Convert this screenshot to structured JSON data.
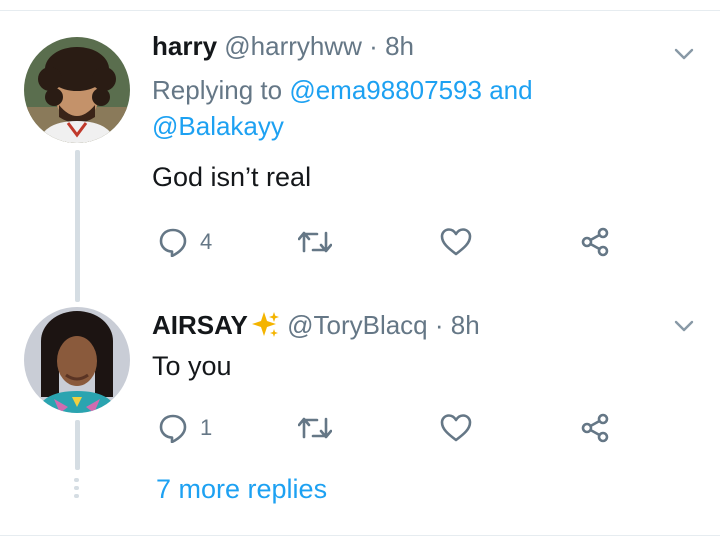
{
  "tweets": [
    {
      "name": "harry",
      "handle": "@harryhww",
      "separator": "·",
      "time": "8h",
      "replying_prefix": "Replying to",
      "reply_mention_1": "@ema98807593",
      "reply_and": "and",
      "reply_mention_2": "@Balakayy",
      "text": "God isn’t real",
      "reply_count": "4"
    },
    {
      "name": "AIRSAY",
      "name_emoji": "sparkles-icon",
      "handle": "@ToryBlacq",
      "separator": "·",
      "time": "8h",
      "text": "To you",
      "reply_count": "1"
    }
  ],
  "more_replies": "7 more replies",
  "icons": {
    "reply": "speech-bubble-icon",
    "retweet": "retweet-icon",
    "like": "heart-icon",
    "share": "share-icon",
    "menu": "chevron-down-icon"
  },
  "colors": {
    "link": "#1da1f2",
    "muted": "#657786",
    "text": "#14171a",
    "thread_line": "#d5dde3",
    "sparkle": "#f4b400"
  }
}
